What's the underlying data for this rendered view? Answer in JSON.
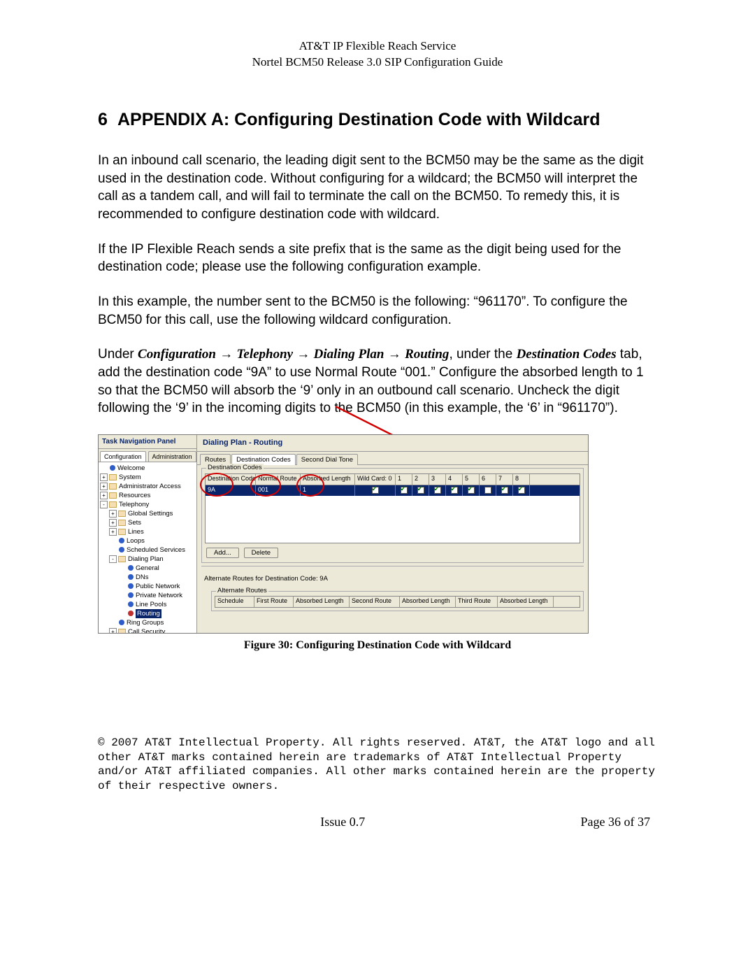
{
  "header": {
    "line1": "AT&T IP Flexible Reach Service",
    "line2": "Nortel BCM50 Release 3.0 SIP Configuration Guide"
  },
  "heading": {
    "number": "6",
    "title": "APPENDIX A: Configuring Destination Code with Wildcard"
  },
  "para1": "In an inbound call scenario, the leading digit sent to the BCM50 may be the same as the digit used in the destination code.  Without configuring for a wildcard; the BCM50 will interpret the call as a tandem call, and will fail to terminate the call on the BCM50.  To remedy this, it is recommended to configure destination code with wildcard.",
  "para2": "If the IP Flexible Reach sends a site prefix that is the same as the digit being used for the destination code; please use the following configuration example.",
  "para3": "In this example, the number sent to the BCM50 is the following: “961170”.  To configure the BCM50 for this call, use the following wildcard configuration.",
  "nav_path": {
    "under": "Under ",
    "p1": "Configuration",
    "p2": "Telephony",
    "p3": "Dialing Plan",
    "p4": "Routing",
    "after_nav": ", under the ",
    "dc_tab": "Destination Codes",
    "tail": " tab, add the destination code “9A” to use Normal Route “001.”  Configure the absorbed length to 1 so that the BCM50 will absorb the ‘9’ only in an outbound call scenario.  Uncheck the digit following the ‘9’ in the incoming digits to the BCM50 (in this example, the ‘6’ in “961170”)."
  },
  "figure_caption": "Figure 30: Configuring Destination Code with Wildcard",
  "screenshot": {
    "nav_title": "Task Navigation Panel",
    "nav_tabs": [
      "Configuration",
      "Administration"
    ],
    "tree": {
      "welcome": "Welcome",
      "system": "System",
      "admin": "Administrator Access",
      "resources": "Resources",
      "telephony": "Telephony",
      "global": "Global Settings",
      "sets": "Sets",
      "lines": "Lines",
      "loops": "Loops",
      "sched": "Scheduled Services",
      "dialing": "Dialing Plan",
      "general": "General",
      "dns": "DNs",
      "pubnet": "Public Network",
      "privnet": "Private Network",
      "linepools": "Line Pools",
      "routing": "Routing",
      "ring": "Ring Groups",
      "callsec": "Call Security"
    },
    "main_title": "Dialing Plan - Routing",
    "main_tabs": [
      "Routes",
      "Destination Codes",
      "Second Dial Tone"
    ],
    "group1_legend": "Destination Codes",
    "columns": {
      "dest": "Destination Code",
      "normal": "Normal Route",
      "abs": "Absorbed Length",
      "wc": "Wild Card: 0",
      "d1": "1",
      "d2": "2",
      "d3": "3",
      "d4": "4",
      "d5": "5",
      "d6": "6",
      "d7": "7",
      "d8": "8"
    },
    "row": {
      "dest": "9A",
      "normal": "001",
      "abs": "1",
      "checks": [
        true,
        true,
        true,
        true,
        true,
        true,
        false,
        true,
        true
      ]
    },
    "buttons": {
      "add": "Add...",
      "delete": "Delete"
    },
    "alt_label": "Alternate Routes for Destination Code: 9A",
    "alt_legend": "Alternate Routes",
    "alt_columns": {
      "schedule": "Schedule",
      "first": "First Route",
      "abs1": "Absorbed Length",
      "second": "Second Route",
      "abs2": "Absorbed Length",
      "third": "Third Route",
      "abs3": "Absorbed Length"
    }
  },
  "copyright": "© 2007 AT&T Intellectual Property. All rights reserved. AT&T, the AT&T logo and all other AT&T marks contained herein are trademarks of AT&T Intellectual Property and/or AT&T affiliated companies.  All other marks contained herein are the property of their respective owners.",
  "footer": {
    "issue": "Issue 0.7",
    "page": "Page 36 of 37"
  }
}
